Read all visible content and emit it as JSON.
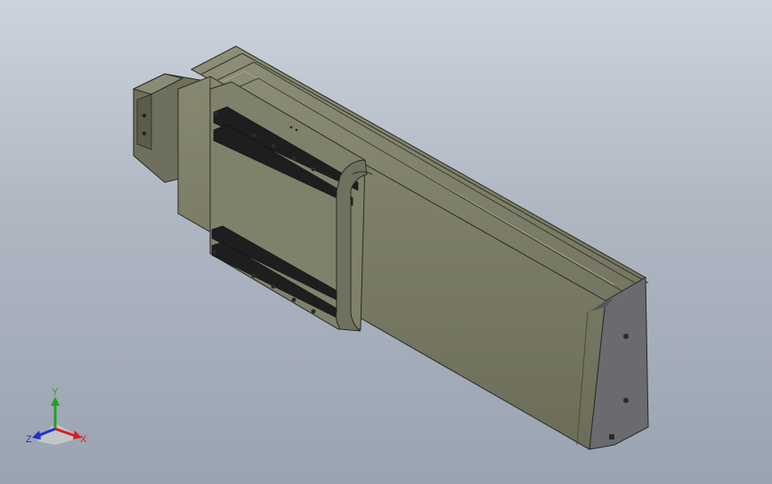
{
  "viewport": {
    "background_top": "#cdd3dc",
    "background_bottom": "#9aa3b1"
  },
  "model": {
    "body_color": "#7a7b65",
    "body_dark": "#5e5f4d",
    "body_light": "#8b8c74",
    "endcap_color": "#6a6b6f",
    "rail_color": "#1e1e1e"
  },
  "triad": {
    "x_label": "X",
    "y_label": "Y",
    "z_label": "Z",
    "x_color": "#d42020",
    "y_color": "#1fa31f",
    "z_color": "#2030d0"
  }
}
